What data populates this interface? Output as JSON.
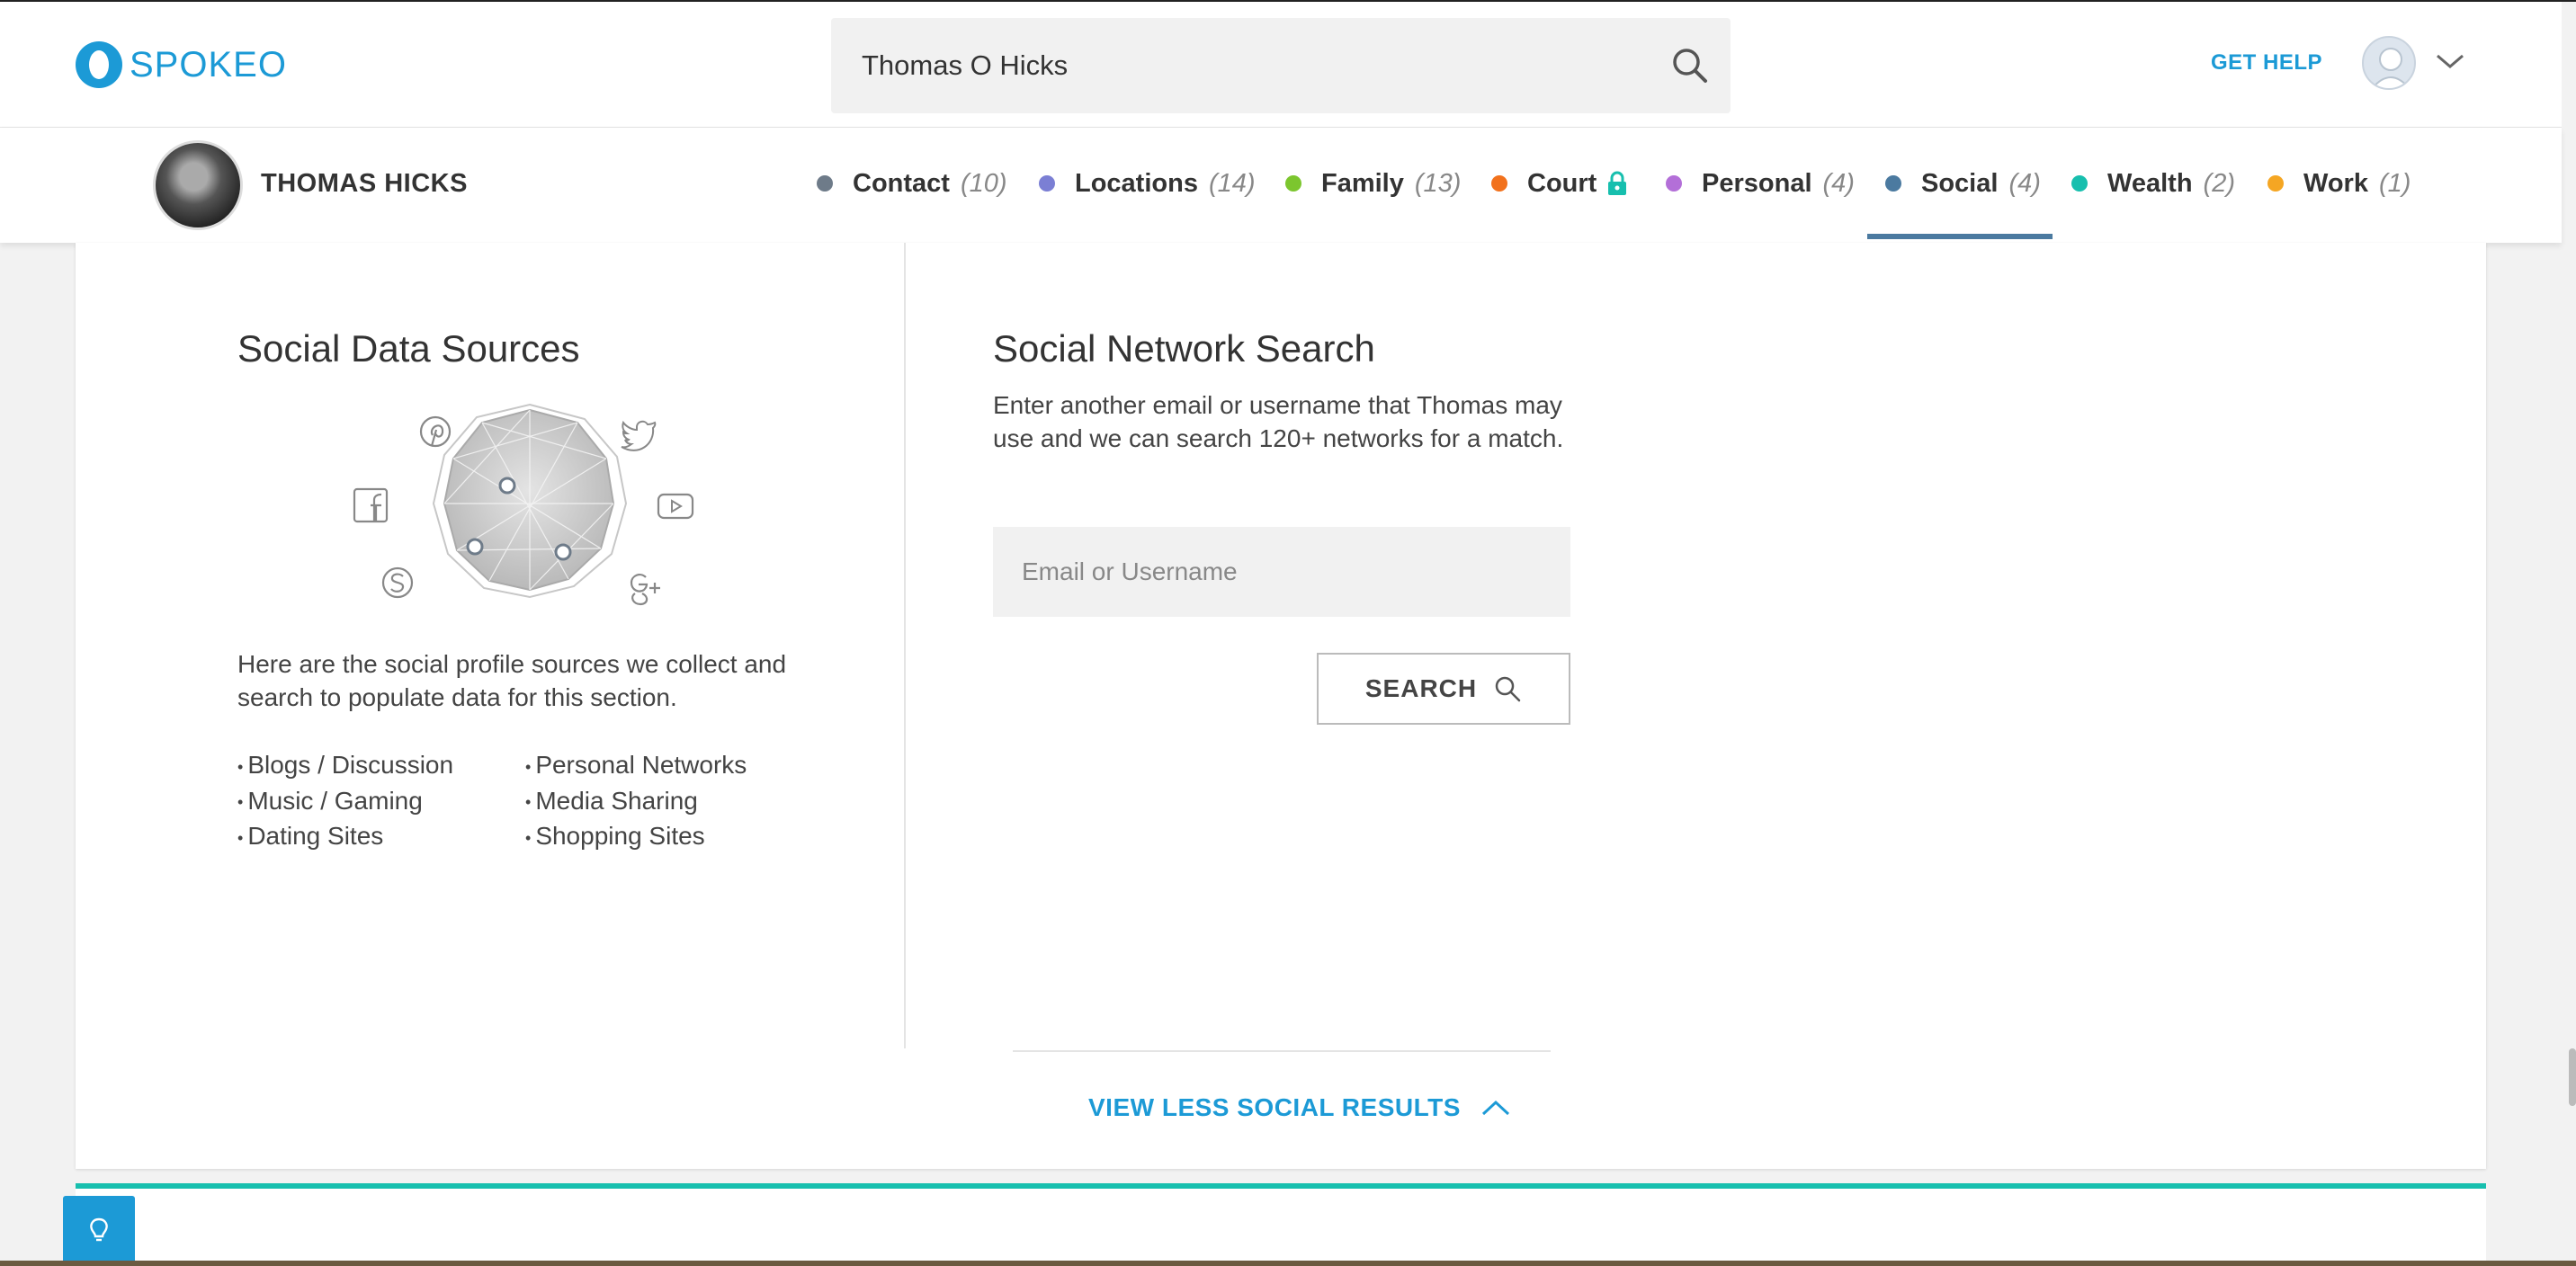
{
  "header": {
    "brand": "SPOKEO",
    "search_value": "Thomas O Hicks",
    "get_help": "GET HELP"
  },
  "profile": {
    "name": "THOMAS HICKS"
  },
  "tabs": [
    {
      "label": "Contact",
      "count": "(10)",
      "color": "#6e7b89"
    },
    {
      "label": "Locations",
      "count": "(14)",
      "color": "#7b7fd4"
    },
    {
      "label": "Family",
      "count": "(13)",
      "color": "#7cc62e"
    },
    {
      "label": "Court",
      "count": "",
      "color": "#f2711c",
      "locked": true
    },
    {
      "label": "Personal",
      "count": "(4)",
      "color": "#b36fd8"
    },
    {
      "label": "Social",
      "count": "(4)",
      "color": "#4b7aa0",
      "active": true
    },
    {
      "label": "Wealth",
      "count": "(2)",
      "color": "#17bfae"
    },
    {
      "label": "Work",
      "count": "(1)",
      "color": "#f5a623"
    }
  ],
  "social_data_sources": {
    "title": "Social Data Sources",
    "description": "Here are the social profile sources we collect and search to populate data for this section.",
    "sources_left": [
      "Blogs / Discussion",
      "Music / Gaming",
      "Dating Sites"
    ],
    "sources_right": [
      "Personal Networks",
      "Media Sharing",
      "Shopping Sites"
    ],
    "network_icons": [
      "pinterest-icon",
      "twitter-icon",
      "facebook-icon",
      "youtube-icon",
      "skype-icon",
      "google-plus-icon"
    ]
  },
  "social_network_search": {
    "title": "Social Network Search",
    "description": "Enter another email or username that Thomas may use and we can search 120+ networks for a match.",
    "input_placeholder": "Email or Username",
    "button_label": "SEARCH"
  },
  "view_less_label": "VIEW LESS SOCIAL RESULTS",
  "colors": {
    "brand": "#1c9ad6",
    "active_tab": "#4b7aa0",
    "wealth_accent": "#17bfae"
  }
}
